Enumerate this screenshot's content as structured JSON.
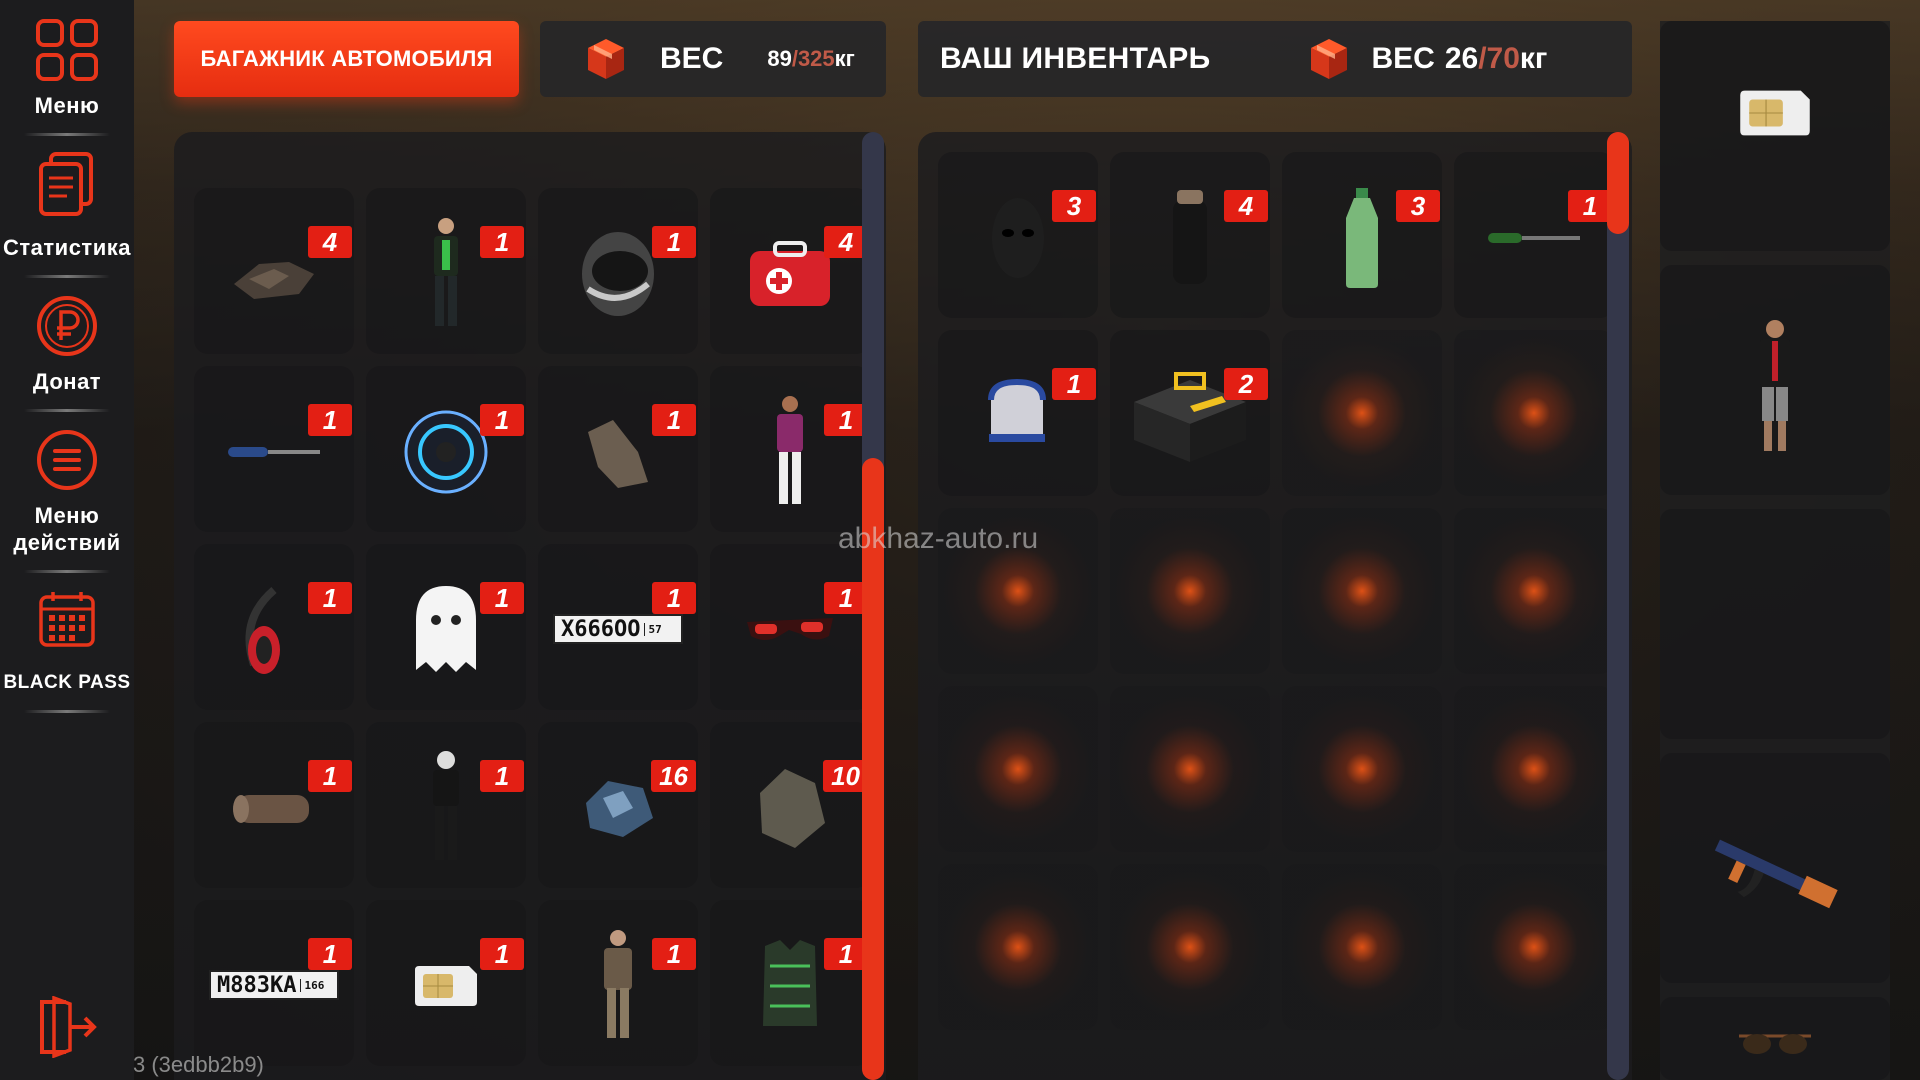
{
  "sidebar": {
    "items": [
      {
        "label": "Меню",
        "icon": "menu-grid-icon"
      },
      {
        "label": "Статистика",
        "icon": "document-icon"
      },
      {
        "label": "Донат",
        "icon": "ruble-icon"
      },
      {
        "label": "Меню",
        "label2": "действий",
        "icon": "action-list-icon"
      },
      {
        "label": "BLACK PASS",
        "icon": "calendar-icon"
      }
    ],
    "exit_icon": "exit-icon"
  },
  "trunk": {
    "title": "БАГАЖНИК АВТОМОБИЛЯ",
    "weight_label": "ВЕС",
    "weight_current": "89",
    "weight_max": "/325",
    "weight_unit": "кг",
    "items": [
      {
        "name": "car-parts",
        "count": "4"
      },
      {
        "name": "green-suit-skin",
        "count": "1"
      },
      {
        "name": "moto-helmet",
        "count": "1"
      },
      {
        "name": "first-aid-kit",
        "count": "4"
      },
      {
        "name": "screwdriver",
        "count": "1"
      },
      {
        "name": "turbo-wheel",
        "count": "1"
      },
      {
        "name": "stone",
        "count": "1"
      },
      {
        "name": "hawaiian-shirt-skin",
        "count": "1"
      },
      {
        "name": "red-headphones",
        "count": "1"
      },
      {
        "name": "ghost-backpack",
        "count": "1"
      },
      {
        "name": "license-plate-x666oo",
        "count": "1",
        "plate": "Х666ОО",
        "region": "57"
      },
      {
        "name": "red-glasses",
        "count": "1"
      },
      {
        "name": "log",
        "count": "1"
      },
      {
        "name": "black-tshirt-skin",
        "count": "1"
      },
      {
        "name": "ore",
        "count": "16"
      },
      {
        "name": "rock",
        "count": "10"
      },
      {
        "name": "license-plate-m883ka",
        "count": "1",
        "plate": "М883КА",
        "region": "166"
      },
      {
        "name": "sim-card",
        "count": "1"
      },
      {
        "name": "suit-old-man-skin",
        "count": "1"
      },
      {
        "name": "armor-vest",
        "count": "1"
      }
    ]
  },
  "inventory": {
    "title": "ВАШ ИНВЕНТАРЬ",
    "weight_label": "ВЕС",
    "weight_current": "26",
    "weight_max": "/70",
    "weight_unit": "кг",
    "items": [
      {
        "name": "balaclava",
        "count": "3"
      },
      {
        "name": "black-thermos",
        "count": "4"
      },
      {
        "name": "water-bottle",
        "count": "3"
      },
      {
        "name": "screwdriver",
        "count": "1"
      },
      {
        "name": "blue-cap",
        "count": "1"
      },
      {
        "name": "toolbox",
        "count": "2"
      }
    ],
    "empty_slots": 14
  },
  "equipment": {
    "slots": [
      "sim-card",
      "player-skin",
      "empty",
      "empty",
      "ak-rifle",
      "sunglasses"
    ]
  },
  "watermark": "abkhaz-auto.ru",
  "version": "3 (3edbb2b9)",
  "colors": {
    "accent": "#e62d10",
    "badge": "#e31f14",
    "scroll_track": "#34374a",
    "weight_max": "#c05a48"
  }
}
